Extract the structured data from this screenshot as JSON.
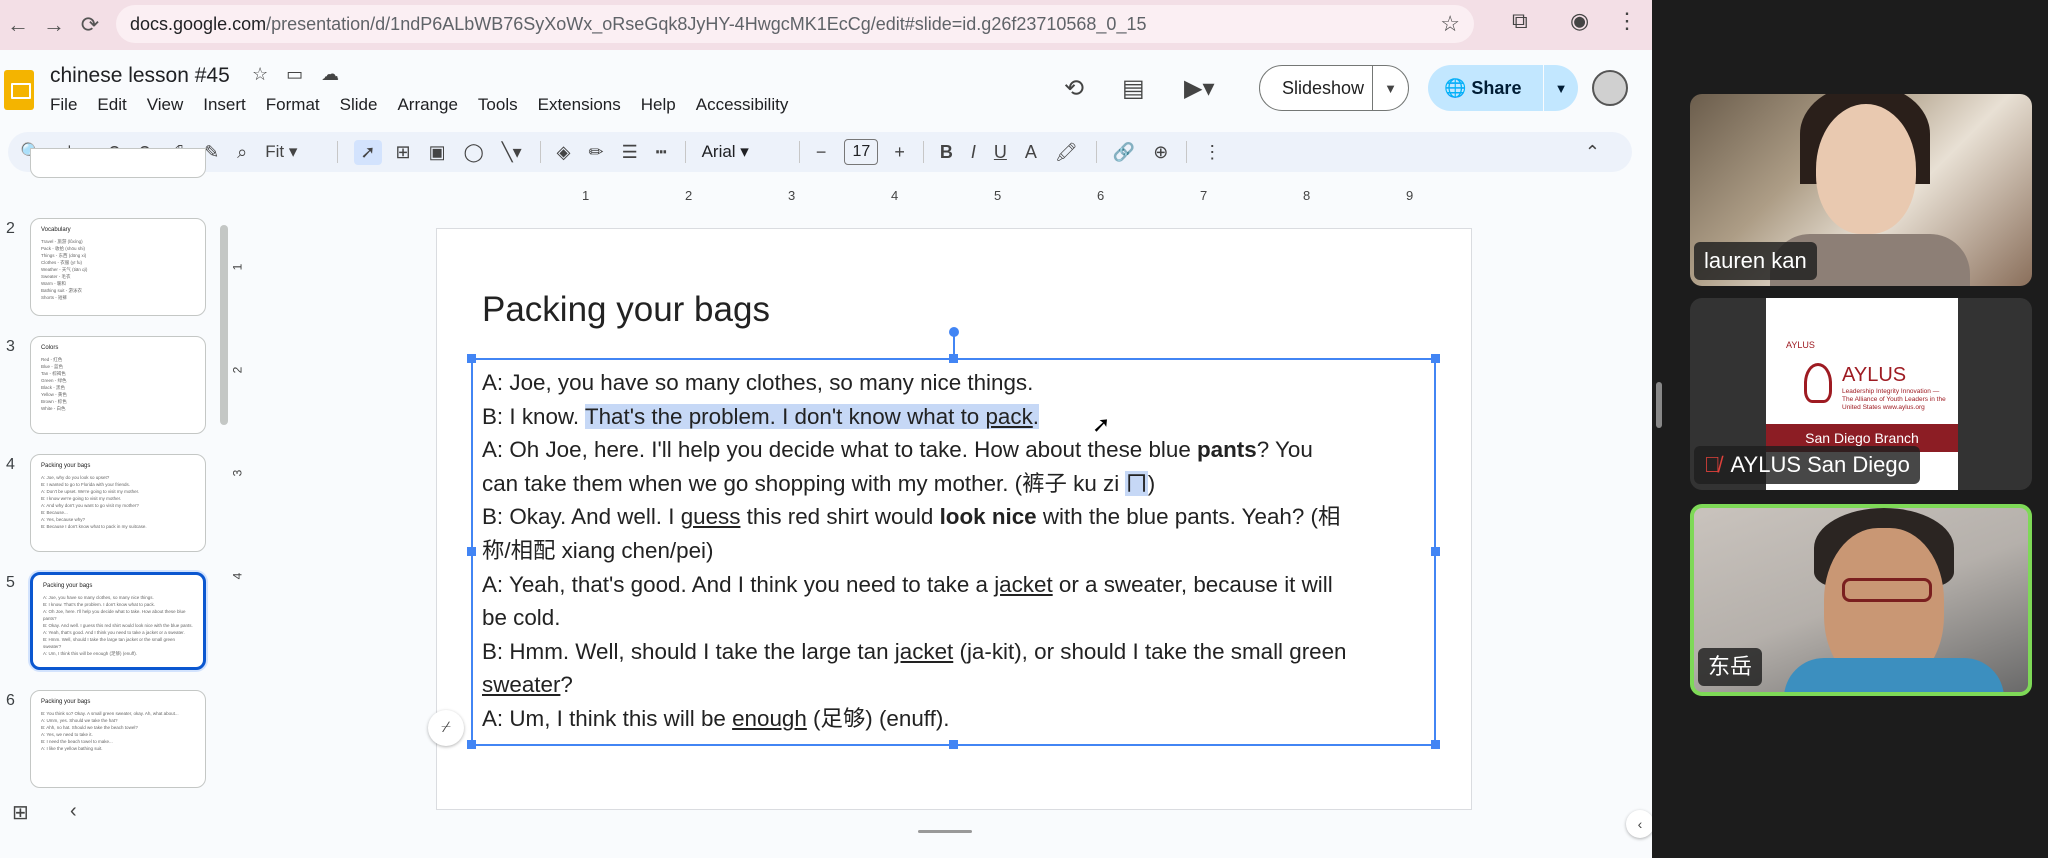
{
  "browser": {
    "url_host": "docs.google.com",
    "url_path": "/presentation/d/1ndP6ALbWB76SyXoWx_oRseGqk8JyHY-4HwgcMK1EcCg/edit#slide=id.g26f23710568_0_15"
  },
  "doc": {
    "title": "chinese lesson #45",
    "menu": [
      "File",
      "Edit",
      "View",
      "Insert",
      "Format",
      "Slide",
      "Arrange",
      "Tools",
      "Extensions",
      "Help",
      "Accessibility"
    ]
  },
  "header": {
    "slideshow_label": "Slideshow",
    "share_label": "Share"
  },
  "toolbar": {
    "zoom": "Fit",
    "font": "Arial",
    "font_size": "17"
  },
  "ruler": [
    "1",
    "2",
    "3",
    "4",
    "5",
    "6",
    "7",
    "8",
    "9"
  ],
  "vruler": [
    "1",
    "2",
    "3",
    "4"
  ],
  "filmstrip": [
    {
      "num": "2",
      "title": "Vocabulary",
      "lines": [
        "Travel - 旅游 (lǚxíng)",
        "Pack - 收拾 (shōu shi)",
        "Things - 东西 (dōng xi)",
        "Clothes - 衣服 (yī fu)",
        "Weather - 天气 (tiān qì)",
        "Sweater - 毛衣",
        "Warm - 暖和",
        "Bathing suit - 游泳衣",
        "Shorts - 短裤"
      ]
    },
    {
      "num": "3",
      "title": "Colors",
      "lines": [
        "Red - 红色",
        "Blue - 蓝色",
        "Tan - 棕褐色",
        "Green - 绿色",
        "Black - 黑色",
        "Yellow - 黄色",
        "Brown - 棕色",
        "White - 白色"
      ]
    },
    {
      "num": "4",
      "title": "Packing your bags",
      "lines": [
        "A: Joe, why do you look so upset?",
        "B: I wanted to go to Florida with your friends.",
        "A: Don't be upset. We're going to visit my mother.",
        "B: I know we're going to visit my mother.",
        "A: And why don't you want to go visit my mother?",
        "B: Because...",
        "A: Yes, because why?",
        "B: Because I don't know what to pack in my suitcase."
      ]
    },
    {
      "num": "5",
      "title": "Packing your bags",
      "lines": [
        "A: Joe, you have so many clothes, so many nice things.",
        "B: I know. That's the problem. I don't know what to pack.",
        "A: Oh Joe, here. I'll help you decide what to take. How about these blue pants?",
        "B: Okay. And well. I guess this red shirt would look nice with the blue pants.",
        "A: Yeah, that's good. And I think you need to take a jacket or a sweater.",
        "B: Hmm. Well, should I take the large tan jacket or the small green sweater?",
        "A: Um, I think this will be enough (足够) (enuff)."
      ]
    },
    {
      "num": "6",
      "title": "Packing your bags",
      "lines": [
        "B: You think so? Okay. A small green sweater, okay. Ah, what about...",
        "A: Umm, yes. Should we take the hat?",
        "B: Ahh, no hat. Should we take the beach towel?",
        "A: Yes, we need to take it.",
        "B: I need the beach towel to make...",
        "A: I like the yellow bathing suit."
      ]
    }
  ],
  "slide": {
    "title": "Packing your bags",
    "lines": [
      {
        "a": "A: Joe, you have so many clothes, so many nice things."
      },
      {
        "a": "B: I know. ",
        "hl1": "That's the problem. I don't know what to ",
        "hlu": "pack",
        "hl2": ".",
        "rest": ""
      },
      {
        "a": "A: Oh Joe, here. I'll help you decide what to take. How about these blue ",
        "b": "pants",
        "c": "? You"
      },
      {
        "a": "can take them when we go shopping with my mother. (裤子 ku zi ",
        "hlm": "ㄇ",
        "c": ")"
      },
      {
        "a": "B: Okay. And well. I ",
        "u": "guess",
        "b1": " this red shirt would ",
        "b": "look nice",
        "c": " with the blue pants. Yeah? (相"
      },
      {
        "a": "称/相配 xiang chen/pei)"
      },
      {
        "a": "A: Yeah, that's good. And I think you need to take a ",
        "u": "jacket",
        "c": " or a sweater, because it will"
      },
      {
        "a": "be cold."
      },
      {
        "a": "B: Hmm. Well, should I take the large tan ",
        "u": "jacket",
        "c": " (ja-kit), or should I take the small green"
      },
      {
        "a": "",
        "u": "sweater",
        "c": "?"
      },
      {
        "a": "A: Um, I think this will be ",
        "u": "enough",
        "c": " (足够) (enuff)."
      }
    ]
  },
  "participants": [
    {
      "name": "lauren kan"
    },
    {
      "name": "AYLUS San Diego",
      "muted": true,
      "card": {
        "small": "AYLUS",
        "big": "AYLUS",
        "sub": "Leadership Integrity Innovation — The Alliance of Youth Leaders in the United States www.aylus.org",
        "band": "San Diego Branch"
      }
    },
    {
      "name": "东岳",
      "active_speaker": true
    }
  ],
  "colors": {
    "accent": "#0b57d0",
    "share_bg": "#c2e7ff",
    "selection": "#c6d8f6",
    "tab_bar": "#f3dfe6",
    "speaker_border": "#7ed957"
  }
}
